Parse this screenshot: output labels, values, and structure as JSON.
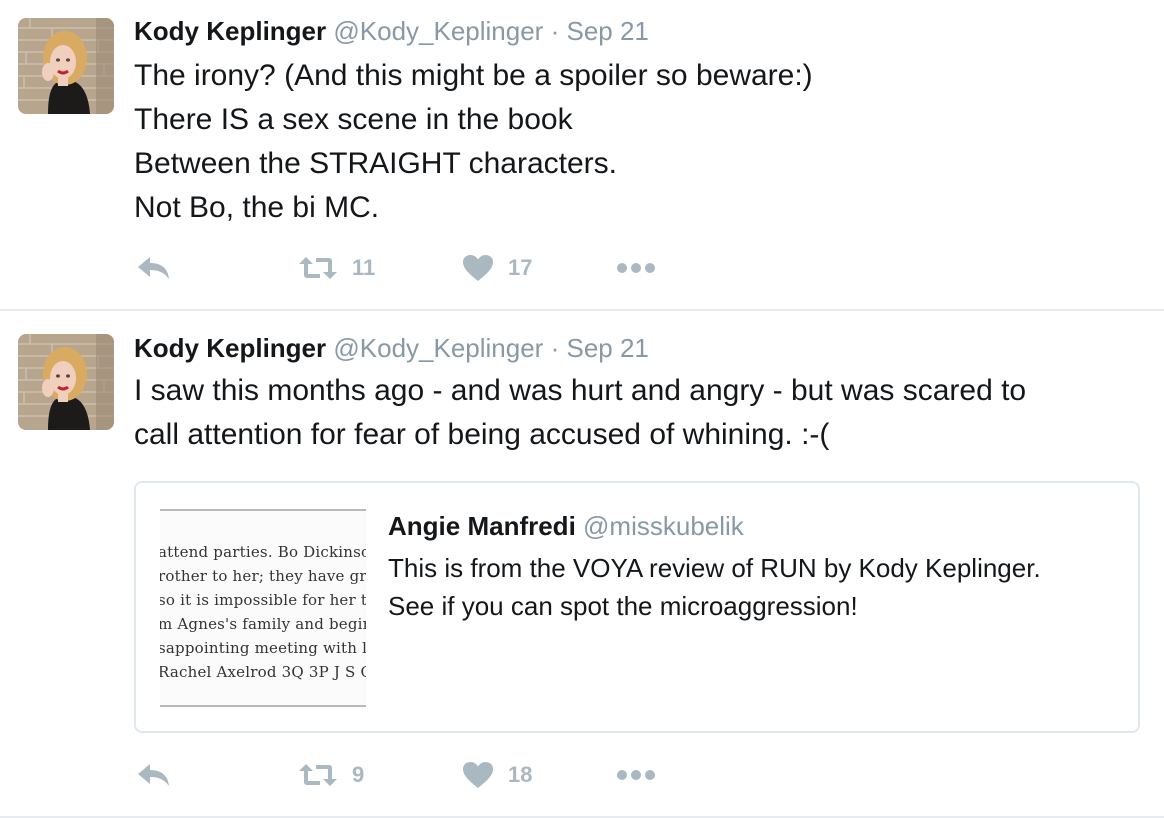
{
  "tweets": [
    {
      "author_name": "Kody Keplinger",
      "handle": "@Kody_Keplinger",
      "separator": "·",
      "date": "Sep 21",
      "lines": [
        "The irony? (And this might be a spoiler so beware:)",
        "There IS a sex scene in the book",
        "Between the STRAIGHT characters.",
        "Not Bo, the bi MC."
      ],
      "retweets": "11",
      "likes": "17"
    },
    {
      "author_name": "Kody Keplinger",
      "handle": "@Kody_Keplinger",
      "separator": "·",
      "date": "Sep 21",
      "lines": [
        "I saw this months ago - and was hurt and angry - but was scared to",
        "call attention for fear of being accused of whining. :-("
      ],
      "retweets": "9",
      "likes": "18",
      "quote": {
        "author_name": "Angie Manfredi",
        "handle": "@misskubelik",
        "lines": [
          "This is from the VOYA review of RUN by Kody Keplinger.",
          "See if you can spot the microaggression!"
        ],
        "image_lines": [
          "attend parties. Bo Dickinso",
          "rother to her; they have gr",
          "so it is impossible for her t",
          "m Agnes's family and begir",
          "sappointing meeting with l",
          "Rachel Axelrod 3Q 3P J S C"
        ]
      }
    }
  ],
  "icons": {
    "reply": "reply-icon",
    "retweet": "retweet-icon",
    "like": "heart-icon",
    "more": "more-icon"
  },
  "colors": {
    "text": "#14171a",
    "muted": "#8899a6",
    "action_icon": "#aab8c2",
    "divider": "#e6ecf0"
  }
}
